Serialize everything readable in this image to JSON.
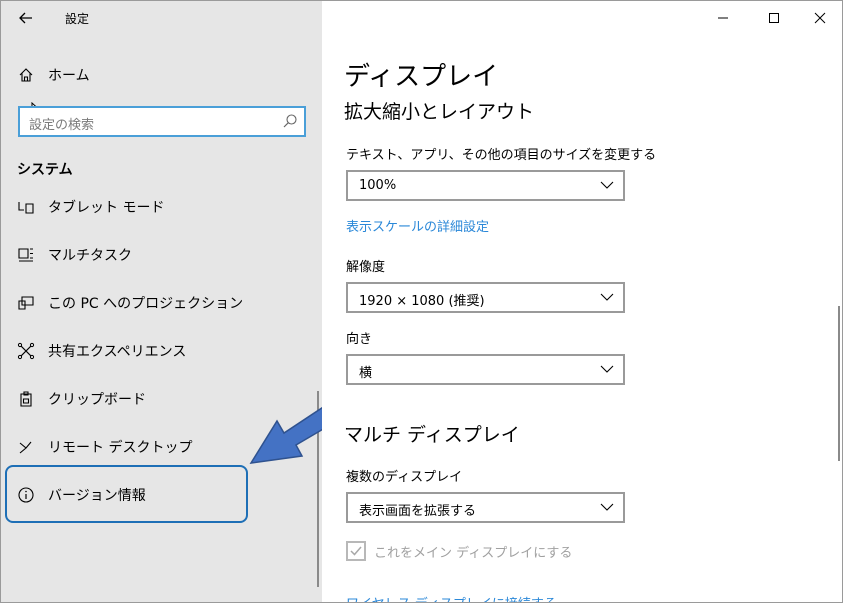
{
  "window": {
    "title": "設定",
    "controls": [
      "minimize-icon",
      "maximize-icon",
      "close-icon"
    ]
  },
  "sidebar": {
    "home_label": "ホーム",
    "search_placeholder": "設定の検索",
    "section_label": "システム",
    "items": [
      {
        "label": "タブレット モード",
        "icon": "tablet-mode-icon"
      },
      {
        "label": "マルチタスク",
        "icon": "multitasking-icon"
      },
      {
        "label": "この PC へのプロジェクション",
        "icon": "projection-icon"
      },
      {
        "label": "共有エクスペリエンス",
        "icon": "shared-experiences-icon"
      },
      {
        "label": "クリップボード",
        "icon": "clipboard-icon"
      },
      {
        "label": "リモート デスクトップ",
        "icon": "remote-desktop-icon"
      },
      {
        "label": "バージョン情報",
        "icon": "info-icon"
      }
    ]
  },
  "main": {
    "page_title": "ディスプレイ",
    "scale_section_title": "拡大縮小とレイアウト",
    "scale_label": "テキスト、アプリ、その他の項目のサイズを変更する",
    "scale_value": "100%",
    "advanced_scale_link": "表示スケールの詳細設定",
    "resolution_label": "解像度",
    "resolution_value": "1920 × 1080 (推奨)",
    "orientation_label": "向き",
    "orientation_value": "横",
    "multi_section_title": "マルチ ディスプレイ",
    "multiple_displays_label": "複数のディスプレイ",
    "multiple_displays_value": "表示画面を拡張する",
    "main_display_checkbox": "これをメイン ディスプレイにする",
    "wireless_link": "ワイヤレス ディスプレイに接続する"
  },
  "colors": {
    "sidebar_bg": "#e6e6e6",
    "accent": "#2b88d8",
    "highlight": "#1e6fb6",
    "arrow": "#4472c4"
  }
}
